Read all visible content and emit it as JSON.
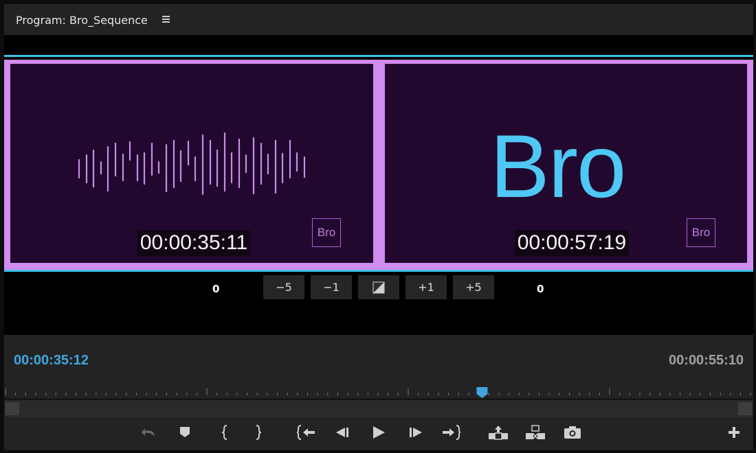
{
  "header": {
    "title": "Program: Bro_Sequence",
    "menu_icon": "hamburger-menu-icon"
  },
  "viewers": {
    "left": {
      "timecode": "00:00:35:11",
      "badge": "Bro"
    },
    "right": {
      "timecode": "00:00:57:19",
      "badge": "Bro",
      "title": "Bro"
    }
  },
  "trim": {
    "left_offset": "0",
    "right_offset": "0",
    "buttons": [
      "−5",
      "−1",
      "◩",
      "+1",
      "+5"
    ]
  },
  "timeline": {
    "current_timecode": "00:00:35:12",
    "duration_timecode": "00:00:55:10",
    "playhead_fraction": 0.638
  },
  "controls": [
    "undo-icon",
    "add-marker-icon",
    "mark-in-icon",
    "mark-out-icon",
    "go-to-in-icon",
    "step-back-icon",
    "play-icon",
    "step-forward-icon",
    "go-to-out-icon",
    "lift-icon",
    "extract-icon",
    "export-frame-icon",
    "add-button-icon"
  ],
  "colors": {
    "accent_blue": "#3fa6e0",
    "cyan_line": "#3fc1e8",
    "frame_purple": "#d18cf0",
    "viewer_bg": "#22082f",
    "bro_blue": "#4fc8f5"
  }
}
